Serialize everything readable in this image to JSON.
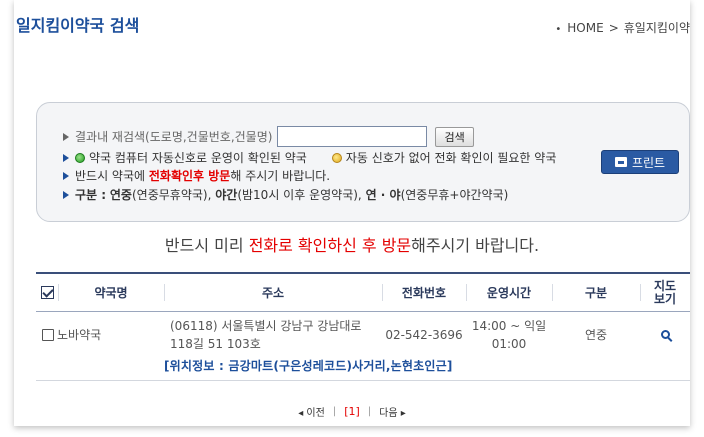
{
  "header": {
    "title": "일지킴이약국 검색",
    "breadcrumb": [
      "HOME",
      "휴일지킴이약"
    ]
  },
  "search": {
    "label": "결과내 재검색(도로명,건물번호,건물명)",
    "value": "",
    "button": "검색"
  },
  "legend": {
    "green": "약국 컴퓨터 자동신호로 운영이 확인된 약국",
    "yellow": "자동 신호가 없어 전화 확인이 필요한 약국"
  },
  "note": {
    "prefix": "반드시 약국에",
    "highlight": "전화확인후 방문",
    "suffix": "해 주시기 바랍니다."
  },
  "category": {
    "label": "구분 :",
    "yeonjung": "연중",
    "yeonjung_desc": "(연중무휴약국),",
    "yagan": "야간",
    "yagan_desc": "(밤10시 이후 운영약국),",
    "both": "연 · 야",
    "both_desc": "(연중무휴+야간약국)"
  },
  "print_button": "프린트",
  "notice": {
    "prefix": "반드시 미리 ",
    "highlight": "전화로 확인하신 후 방문",
    "suffix": "해주시기 바랍니다."
  },
  "table": {
    "columns": [
      "약국명",
      "주소",
      "전화번호",
      "운영시간",
      "구분",
      "지도",
      "보기"
    ],
    "rows": [
      {
        "name": "노바약국",
        "addr1": "(06118) 서울특별시 강남구 강남대로",
        "addr2": "118길 51 103호",
        "phone": "02-542-3696",
        "hours1": "14:00 ~ 익일",
        "hours2": "01:00",
        "type": "연중",
        "location": "[위치정보 : 금강마트(구은성레코드)사거리,논현초인근]"
      }
    ]
  },
  "pager": {
    "prev": "◂ 이전",
    "current": "[1]",
    "next": "다음 ▸"
  }
}
